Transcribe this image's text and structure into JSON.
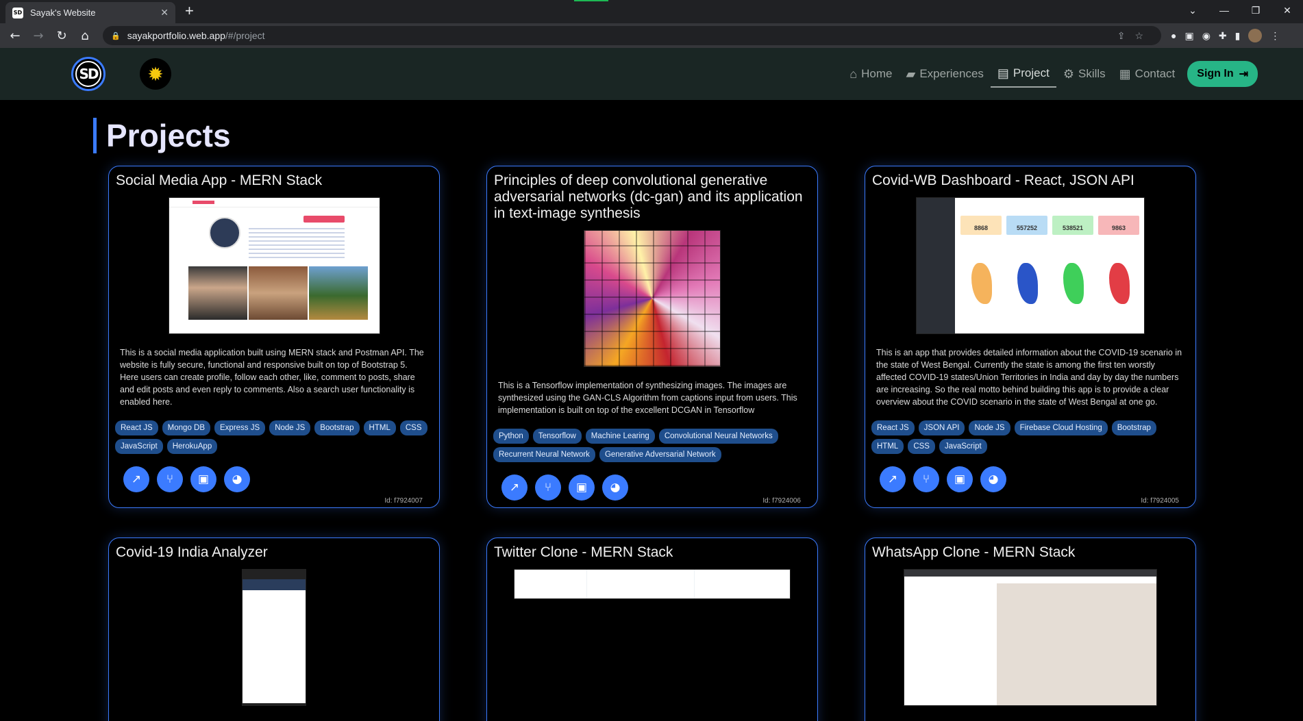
{
  "browser": {
    "tab_title": "Sayak's Website",
    "favicon_text": "SD",
    "url_host": "sayakportfolio.web.app",
    "url_path": "/#/project"
  },
  "nav": {
    "logo_text": "SD",
    "links": [
      {
        "label": "Home",
        "icon": "home-icon"
      },
      {
        "label": "Experiences",
        "icon": "briefcase-icon"
      },
      {
        "label": "Project",
        "icon": "clipboard-icon"
      },
      {
        "label": "Skills",
        "icon": "gear-icon"
      },
      {
        "label": "Contact",
        "icon": "contact-card-icon"
      }
    ],
    "active": "Project",
    "signin_label": "Sign In"
  },
  "page": {
    "title": "Projects"
  },
  "projects": [
    {
      "title": "Social Media App - MERN Stack",
      "description": "This is a social media application built using MERN stack and Postman API. The website is fully secure, functional and responsive built on top of Bootstrap 5. Here users can create profile, follow each other, like, comment to posts, share and edit posts and even reply to comments. Also a search user functionality is enabled here.",
      "tags": [
        "React JS",
        "Mongo DB",
        "Express JS",
        "Node JS",
        "Bootstrap",
        "HTML",
        "CSS",
        "JavaScript",
        "HerokuApp"
      ],
      "id": "Id: f7924007"
    },
    {
      "title": "Principles of deep convolutional generative adversarial networks (dc-gan) and its application in text-image synthesis",
      "description": "This is a Tensorflow implementation of synthesizing images. The images are synthesized using the GAN-CLS Algorithm from captions input from users. This implementation is built on top of the excellent DCGAN in Tensorflow",
      "tags": [
        "Python",
        "Tensorflow",
        "Machine Learing",
        "Convolutional Neural Networks",
        "Recurrent Neural Network",
        "Generative Adversarial Network"
      ],
      "id": "Id: f7924006"
    },
    {
      "title": "Covid-WB Dashboard - React, JSON API",
      "description": "This is an app that provides detailed information about the COVID-19 scenario in the state of West Bengal. Currently the state is among the first ten worstly affected COVID-19 states/Union Territories in India and day by day the numbers are increasing. So the real motto behind building this app is to provide a clear overview about the COVID scenario in the state of West Bengal at one go.",
      "tags": [
        "React JS",
        "JSON API",
        "Node JS",
        "Firebase Cloud Hosting",
        "Bootstrap",
        "HTML",
        "CSS",
        "JavaScript"
      ],
      "id": "Id: f7924005",
      "thumb_stats": [
        "8868",
        "557252",
        "538521",
        "9863"
      ]
    },
    {
      "title": "Covid-19 India Analyzer"
    },
    {
      "title": "Twitter Clone - MERN Stack"
    },
    {
      "title": "WhatsApp Clone - MERN Stack"
    }
  ],
  "colors": {
    "accent": "#3b7bff",
    "nav_bg": "#1a2624",
    "signin_bg": "#27b586",
    "tag_bg": "#1f4e8c"
  }
}
